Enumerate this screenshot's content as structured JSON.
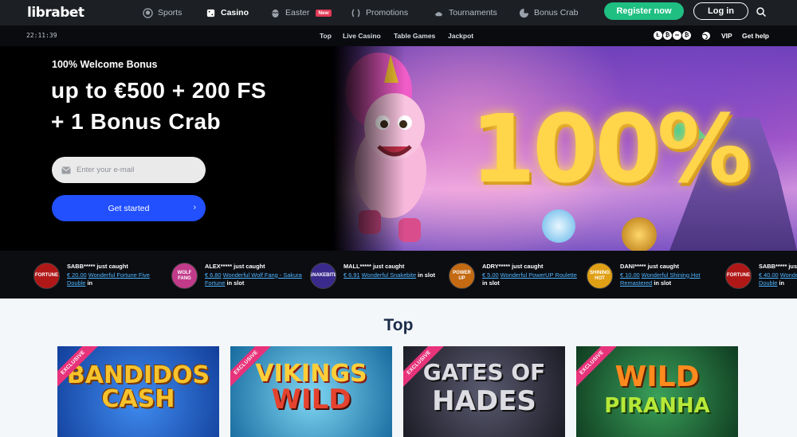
{
  "brand": {
    "logo_main": "libra",
    "logo_accent": "bet"
  },
  "nav": {
    "items": [
      {
        "label": "Sports",
        "icon": "soccer-ball-icon"
      },
      {
        "label": "Casino",
        "icon": "dice-icon",
        "active": true
      },
      {
        "label": "Easter",
        "icon": "easter-egg-icon",
        "badge": "New"
      },
      {
        "label": "Promotions",
        "icon": "laurel-icon"
      },
      {
        "label": "Tournaments",
        "icon": "crab-icon"
      },
      {
        "label": "Bonus Crab",
        "icon": "claw-icon"
      }
    ],
    "register_label": "Register now",
    "login_label": "Log in"
  },
  "subbar": {
    "time": "22:11:39",
    "links": [
      "Top",
      "Live Casino",
      "Table Games",
      "Jackpot"
    ],
    "crypto": [
      "Ł",
      "₿",
      "∞",
      "₿"
    ],
    "vip_label": "VIP",
    "help_label": "Get help"
  },
  "hero": {
    "subtitle": "100% Welcome Bonus",
    "title_line1": "up to €500 + 200 FS",
    "title_line2": "+ 1 Bonus Crab",
    "email_placeholder": "Enter your e-mail",
    "cta_label": "Get started",
    "promo_text": "100%"
  },
  "winners": [
    {
      "user": "SABB***** just caught",
      "amount": "€ 20.00",
      "game": "Wonderful Fortune Five Double",
      "suffix": "in",
      "thumb": "FORTUNE",
      "thumb_color": "#b01818"
    },
    {
      "user": "ALEX***** just caught",
      "amount": "€ 6.80",
      "game": "Wonderful Wolf Fang - Sakura Fortune",
      "suffix": "in slot",
      "thumb": "WOLF FANG",
      "thumb_color": "#c23a8a"
    },
    {
      "user": "MALL***** just caught",
      "amount": "€ 6.91",
      "game": "Wonderful Snakebite",
      "suffix": "in slot",
      "thumb": "SNAKEBITE",
      "thumb_color": "#3a2a8c"
    },
    {
      "user": "ADRY***** just caught",
      "amount": "€ 5.00",
      "game": "Wonderful PowerUP Roulette",
      "suffix": "in slot",
      "thumb": "POWER UP",
      "thumb_color": "#c46a12"
    },
    {
      "user": "DANI***** just caught",
      "amount": "€ 10.00",
      "game": "Wonderful Shining Hot Remastered",
      "suffix": "in slot",
      "thumb": "SHINING HOT",
      "thumb_color": "#e0a015"
    },
    {
      "user": "SABB***** just caught",
      "amount": "€ 40.00",
      "game": "Wonderful Fortune Five Double",
      "suffix": "in",
      "thumb": "FORTUNE",
      "thumb_color": "#b01818"
    }
  ],
  "top_section": {
    "title": "Top",
    "games": [
      {
        "ribbon": "EXCLUSIVE",
        "title_line1": "BANDIDOS",
        "title_line2": "CASH",
        "bg": "#1b5fd1",
        "fg": "#f6c22d"
      },
      {
        "ribbon": "EXCLUSIVE",
        "title_line1": "VIKINGS",
        "title_line2": "WILD",
        "bg": "#1a9fc9",
        "fg": "#e5432f"
      },
      {
        "ribbon": "EXCLUSIVE",
        "title_line1": "GATES OF",
        "title_line2": "HADES",
        "bg": "#3a3a4a",
        "fg": "#d9d9de"
      },
      {
        "ribbon": "EXCLUSIVE",
        "title_line1": "WILD",
        "title_line2": "PIRANHA",
        "bg": "#1f6d3b",
        "fg": "#ff8a1e"
      }
    ]
  }
}
